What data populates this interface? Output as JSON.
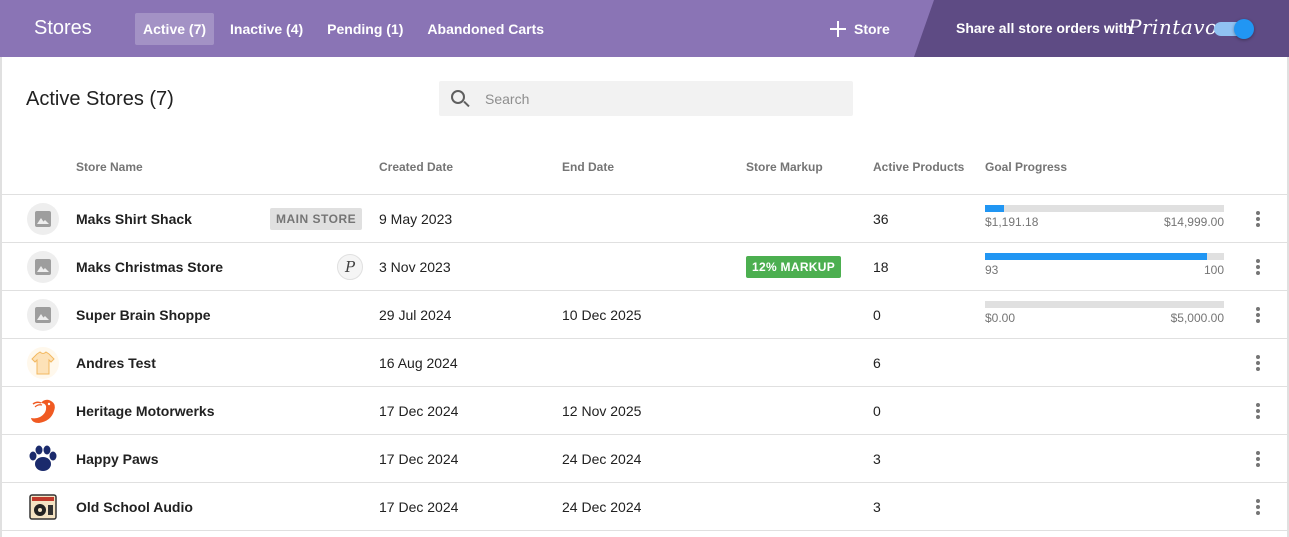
{
  "header": {
    "brand": "Stores",
    "tabs": [
      {
        "label": "Active (7)"
      },
      {
        "label": "Inactive (4)"
      },
      {
        "label": "Pending (1)"
      },
      {
        "label": "Abandoned Carts"
      }
    ],
    "add_store_label": "Store",
    "share_text": "Share all store orders with",
    "printavo_logo": "Printavo",
    "share_toggle_on": true
  },
  "page": {
    "title": "Active Stores (7)",
    "search_placeholder": "Search"
  },
  "table": {
    "columns": [
      "Store Name",
      "Created Date",
      "End Date",
      "Store Markup",
      "Active Products",
      "Goal Progress"
    ],
    "rows": [
      {
        "name": "Maks Shirt Shack",
        "badge": "MAIN STORE",
        "created": "9 May 2023",
        "end": "",
        "markup": "",
        "products": "36",
        "image": "placeholder-icon",
        "goal": {
          "min": "$1,191.18",
          "max": "$14,999.00",
          "fraction": 0.08
        }
      },
      {
        "name": "Maks Christmas Store",
        "printavo_badge": "P",
        "created": "3 Nov 2023",
        "end": "",
        "markup": "12% MARKUP",
        "products": "18",
        "image": "placeholder-icon",
        "goal": {
          "min": "93",
          "max": "100",
          "fraction": 0.93
        }
      },
      {
        "name": "Super Brain Shoppe",
        "created": "29 Jul 2024",
        "end": "10 Dec 2025",
        "markup": "",
        "products": "0",
        "image": "placeholder-icon",
        "goal": {
          "min": "$0.00",
          "max": "$5,000.00",
          "fraction": 0
        }
      },
      {
        "name": "Andres Test",
        "created": "16 Aug 2024",
        "end": "",
        "markup": "",
        "products": "6",
        "image": "shirt-icon"
      },
      {
        "name": "Heritage Motorwerks",
        "created": "17 Dec 2024",
        "end": "12 Nov 2025",
        "markup": "",
        "products": "0",
        "image": "shrimp-logo"
      },
      {
        "name": "Happy Paws",
        "created": "17 Dec 2024",
        "end": "24 Dec 2024",
        "markup": "",
        "products": "3",
        "image": "paw-logo"
      },
      {
        "name": "Old School Audio",
        "created": "17 Dec 2024",
        "end": "24 Dec 2024",
        "markup": "",
        "products": "3",
        "image": "radio-logo"
      }
    ]
  },
  "colors": {
    "topbar": "#8a74b5",
    "share_panel": "#5e4b84",
    "progress": "#2196f3",
    "markup_badge": "#4caf50"
  }
}
